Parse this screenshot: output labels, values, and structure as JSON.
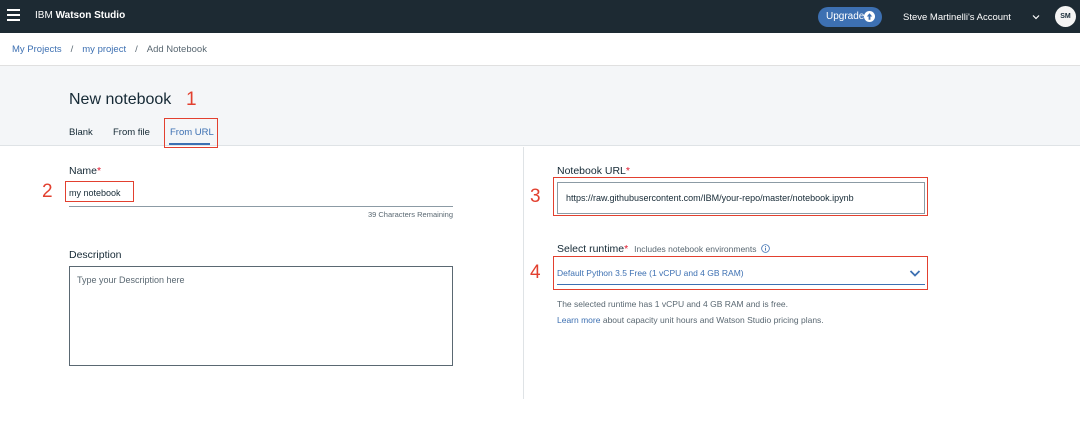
{
  "nav": {
    "brand_prefix": "IBM",
    "brand_product": "Watson Studio",
    "upgrade_label": "Upgrade",
    "account_label": "Steve Martinelli's Account",
    "avatar_initials": "SM"
  },
  "breadcrumb": {
    "items": [
      "My Projects",
      "my project",
      "Add Notebook"
    ],
    "separator": "/"
  },
  "page": {
    "title": "New notebook",
    "tabs": [
      "Blank",
      "From file",
      "From URL"
    ],
    "selected_tab": "From URL"
  },
  "form": {
    "name": {
      "label": "Name",
      "required_marker": "*",
      "value": "my notebook",
      "remaining_text": "39 Characters Remaining"
    },
    "description": {
      "label": "Description",
      "placeholder": "Type your Description here"
    },
    "notebook_url": {
      "label": "Notebook URL",
      "required_marker": "*",
      "value": "https://raw.githubusercontent.com/IBM/your-repo/master/notebook.ipynb"
    },
    "runtime": {
      "label": "Select runtime",
      "required_marker": "*",
      "sublabel": "Includes notebook environments",
      "selected": "Default Python 3.5 Free (1 vCPU and 4 GB RAM)",
      "info_line": "The selected runtime has 1 vCPU and 4 GB RAM and is free.",
      "learn_more_link": "Learn more",
      "learn_more_rest": "about capacity unit hours and Watson Studio pricing plans."
    }
  },
  "annotations": [
    "1",
    "2",
    "3",
    "4"
  ],
  "colors": {
    "nav_bg": "#1d2a33",
    "accent": "#3d70b2",
    "annotation": "#e2402f",
    "required": "#e0182d"
  }
}
